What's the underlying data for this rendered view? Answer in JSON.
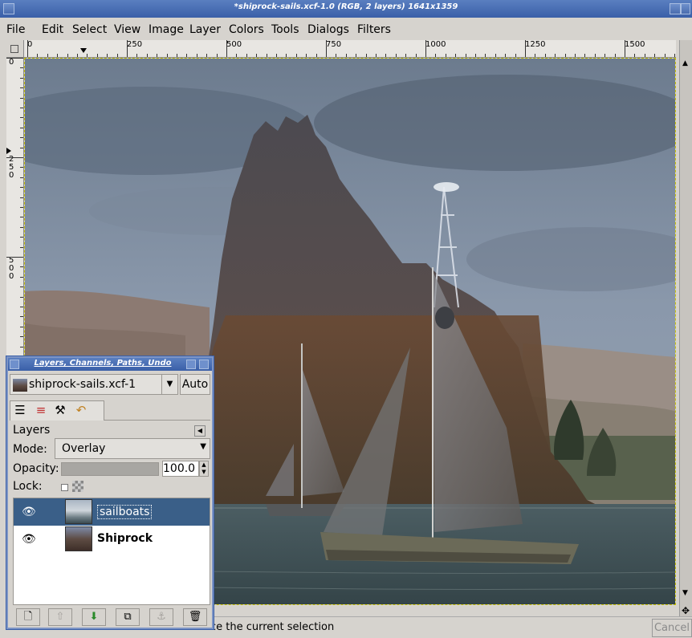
{
  "window": {
    "title": "*shiprock-sails.xcf-1.0 (RGB, 2 layers) 1641x1359"
  },
  "menubar": {
    "items": [
      "File",
      "Edit",
      "Select",
      "View",
      "Image",
      "Layer",
      "Colors",
      "Tools",
      "Dialogs",
      "Filters"
    ]
  },
  "rulers": {
    "horizontal_labels": [
      "0",
      "250",
      "500",
      "750",
      "1000",
      "1250",
      "1500"
    ],
    "vertical_labels": [
      "0",
      "250",
      "500"
    ]
  },
  "status": {
    "text": "ce the current selection",
    "cancel_label": "Cancel"
  },
  "layers_dialog": {
    "title": "Layers, Channels, Paths, Undo",
    "image_name": "shiprock-sails.xcf-1",
    "auto_label": "Auto",
    "section_label": "Layers",
    "mode_label": "Mode:",
    "mode_value": "Overlay",
    "opacity_label": "Opacity:",
    "opacity_value": "100.0",
    "opacity_fraction": 1.0,
    "lock_label": "Lock:",
    "layers": [
      {
        "name": "sailboats",
        "selected": true
      },
      {
        "name": "Shiprock",
        "selected": false
      }
    ],
    "buttons": [
      "new-layer",
      "raise-layer",
      "lower-layer",
      "duplicate-layer",
      "anchor-layer",
      "delete-layer"
    ]
  },
  "colors": {
    "titlebar": "#3a5fa8",
    "selected_row": "#3a5f88"
  }
}
